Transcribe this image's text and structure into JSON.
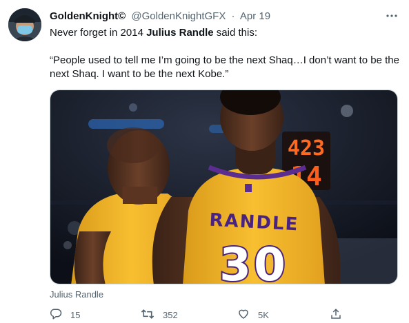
{
  "author": {
    "name": "GoldenKnight",
    "handle": "@GoldenKnightGFX",
    "separator": "·",
    "date": "Apr 19",
    "badge": "©"
  },
  "tweet": {
    "line1_prefix": "Never forget in 2014 ",
    "line1_bold": "Julius Randle",
    "line1_suffix": " said this:",
    "quote": "“People used to tell me I’m going to be the next Shaq…I don’t want to be the next Shaq. I want to be the next Kobe.”"
  },
  "media": {
    "caption": "Julius Randle",
    "jersey_name": "RANDLE",
    "jersey_number": "30",
    "scoreboard_top": "423",
    "scoreboard_bottom": "14"
  },
  "actions": {
    "reply_count": "15",
    "retweet_count": "352",
    "like_count": "5K"
  },
  "icons": {
    "more": "more-horizontal-icon",
    "reply": "reply-icon",
    "retweet": "retweet-icon",
    "like": "heart-icon",
    "share": "share-icon"
  },
  "colors": {
    "text": "#0f1419",
    "secondary": "#536471",
    "lakers_gold": "#f6b62a",
    "lakers_purple": "#5b2d90"
  }
}
